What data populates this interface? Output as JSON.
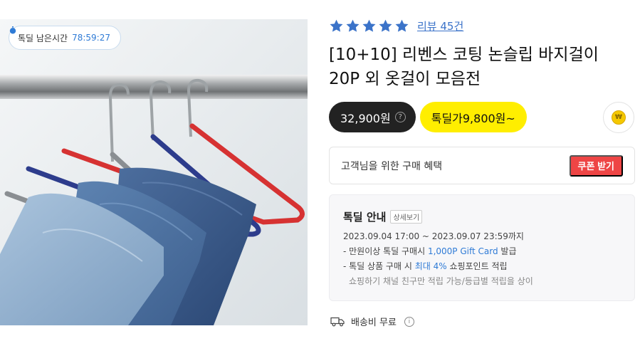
{
  "image": {
    "alt_icon": "hanger-product-photo",
    "timer_label": "톡딜 남은시간",
    "timer_value": "78:59:27"
  },
  "rating": {
    "stars": 5,
    "review_text": "리뷰 45건"
  },
  "title_line1": "[10+10] 리벤스 코팅 논슬립 바지걸이",
  "title_line2": "20P 외 옷걸이 모음전",
  "price": {
    "regular": "32,900원",
    "help": "?",
    "deal": "톡딜가9,800원~",
    "coin_symbol": "₩"
  },
  "benefit": {
    "label": "고객님을 위한 구매 혜택",
    "coupon_button": "쿠폰 받기"
  },
  "deal_info": {
    "title": "톡딜 안내",
    "detail_button": "상세보기",
    "period": "2023.09.04 17:00 ~ 2023.09.07 23:59까지",
    "line1_prefix": "- 만원이상 톡딜 구매시 ",
    "line1_highlight": "1,000P Gift Card",
    "line1_suffix": " 발급",
    "line2_prefix": "- 톡딜 상품 구매 시 ",
    "line2_highlight": "최대 4%",
    "line2_suffix": " 쇼핑포인트 적립",
    "note": "쇼핑하기 채널 친구만 적립 가능/등급별 적립을 상이"
  },
  "shipping": {
    "label": "배송비 무료",
    "info": "i"
  },
  "colors": {
    "accent_blue": "#2f7bd6",
    "deal_yellow": "#ffee00",
    "coupon_red": "#ee4545",
    "star_blue": "#3b73c9"
  }
}
